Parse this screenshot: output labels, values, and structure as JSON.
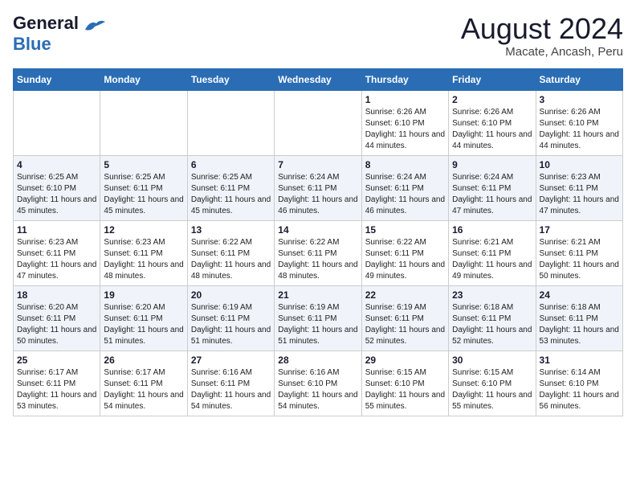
{
  "header": {
    "logo_line1": "General",
    "logo_line2": "Blue",
    "title": "August 2024",
    "subtitle": "Macate, Ancash, Peru"
  },
  "weekdays": [
    "Sunday",
    "Monday",
    "Tuesday",
    "Wednesday",
    "Thursday",
    "Friday",
    "Saturday"
  ],
  "weeks": [
    [
      {
        "day": "",
        "info": ""
      },
      {
        "day": "",
        "info": ""
      },
      {
        "day": "",
        "info": ""
      },
      {
        "day": "",
        "info": ""
      },
      {
        "day": "1",
        "info": "Sunrise: 6:26 AM\nSunset: 6:10 PM\nDaylight: 11 hours and 44 minutes."
      },
      {
        "day": "2",
        "info": "Sunrise: 6:26 AM\nSunset: 6:10 PM\nDaylight: 11 hours and 44 minutes."
      },
      {
        "day": "3",
        "info": "Sunrise: 6:26 AM\nSunset: 6:10 PM\nDaylight: 11 hours and 44 minutes."
      }
    ],
    [
      {
        "day": "4",
        "info": "Sunrise: 6:25 AM\nSunset: 6:10 PM\nDaylight: 11 hours and 45 minutes."
      },
      {
        "day": "5",
        "info": "Sunrise: 6:25 AM\nSunset: 6:11 PM\nDaylight: 11 hours and 45 minutes."
      },
      {
        "day": "6",
        "info": "Sunrise: 6:25 AM\nSunset: 6:11 PM\nDaylight: 11 hours and 45 minutes."
      },
      {
        "day": "7",
        "info": "Sunrise: 6:24 AM\nSunset: 6:11 PM\nDaylight: 11 hours and 46 minutes."
      },
      {
        "day": "8",
        "info": "Sunrise: 6:24 AM\nSunset: 6:11 PM\nDaylight: 11 hours and 46 minutes."
      },
      {
        "day": "9",
        "info": "Sunrise: 6:24 AM\nSunset: 6:11 PM\nDaylight: 11 hours and 47 minutes."
      },
      {
        "day": "10",
        "info": "Sunrise: 6:23 AM\nSunset: 6:11 PM\nDaylight: 11 hours and 47 minutes."
      }
    ],
    [
      {
        "day": "11",
        "info": "Sunrise: 6:23 AM\nSunset: 6:11 PM\nDaylight: 11 hours and 47 minutes."
      },
      {
        "day": "12",
        "info": "Sunrise: 6:23 AM\nSunset: 6:11 PM\nDaylight: 11 hours and 48 minutes."
      },
      {
        "day": "13",
        "info": "Sunrise: 6:22 AM\nSunset: 6:11 PM\nDaylight: 11 hours and 48 minutes."
      },
      {
        "day": "14",
        "info": "Sunrise: 6:22 AM\nSunset: 6:11 PM\nDaylight: 11 hours and 48 minutes."
      },
      {
        "day": "15",
        "info": "Sunrise: 6:22 AM\nSunset: 6:11 PM\nDaylight: 11 hours and 49 minutes."
      },
      {
        "day": "16",
        "info": "Sunrise: 6:21 AM\nSunset: 6:11 PM\nDaylight: 11 hours and 49 minutes."
      },
      {
        "day": "17",
        "info": "Sunrise: 6:21 AM\nSunset: 6:11 PM\nDaylight: 11 hours and 50 minutes."
      }
    ],
    [
      {
        "day": "18",
        "info": "Sunrise: 6:20 AM\nSunset: 6:11 PM\nDaylight: 11 hours and 50 minutes."
      },
      {
        "day": "19",
        "info": "Sunrise: 6:20 AM\nSunset: 6:11 PM\nDaylight: 11 hours and 51 minutes."
      },
      {
        "day": "20",
        "info": "Sunrise: 6:19 AM\nSunset: 6:11 PM\nDaylight: 11 hours and 51 minutes."
      },
      {
        "day": "21",
        "info": "Sunrise: 6:19 AM\nSunset: 6:11 PM\nDaylight: 11 hours and 51 minutes."
      },
      {
        "day": "22",
        "info": "Sunrise: 6:19 AM\nSunset: 6:11 PM\nDaylight: 11 hours and 52 minutes."
      },
      {
        "day": "23",
        "info": "Sunrise: 6:18 AM\nSunset: 6:11 PM\nDaylight: 11 hours and 52 minutes."
      },
      {
        "day": "24",
        "info": "Sunrise: 6:18 AM\nSunset: 6:11 PM\nDaylight: 11 hours and 53 minutes."
      }
    ],
    [
      {
        "day": "25",
        "info": "Sunrise: 6:17 AM\nSunset: 6:11 PM\nDaylight: 11 hours and 53 minutes."
      },
      {
        "day": "26",
        "info": "Sunrise: 6:17 AM\nSunset: 6:11 PM\nDaylight: 11 hours and 54 minutes."
      },
      {
        "day": "27",
        "info": "Sunrise: 6:16 AM\nSunset: 6:11 PM\nDaylight: 11 hours and 54 minutes."
      },
      {
        "day": "28",
        "info": "Sunrise: 6:16 AM\nSunset: 6:10 PM\nDaylight: 11 hours and 54 minutes."
      },
      {
        "day": "29",
        "info": "Sunrise: 6:15 AM\nSunset: 6:10 PM\nDaylight: 11 hours and 55 minutes."
      },
      {
        "day": "30",
        "info": "Sunrise: 6:15 AM\nSunset: 6:10 PM\nDaylight: 11 hours and 55 minutes."
      },
      {
        "day": "31",
        "info": "Sunrise: 6:14 AM\nSunset: 6:10 PM\nDaylight: 11 hours and 56 minutes."
      }
    ]
  ]
}
